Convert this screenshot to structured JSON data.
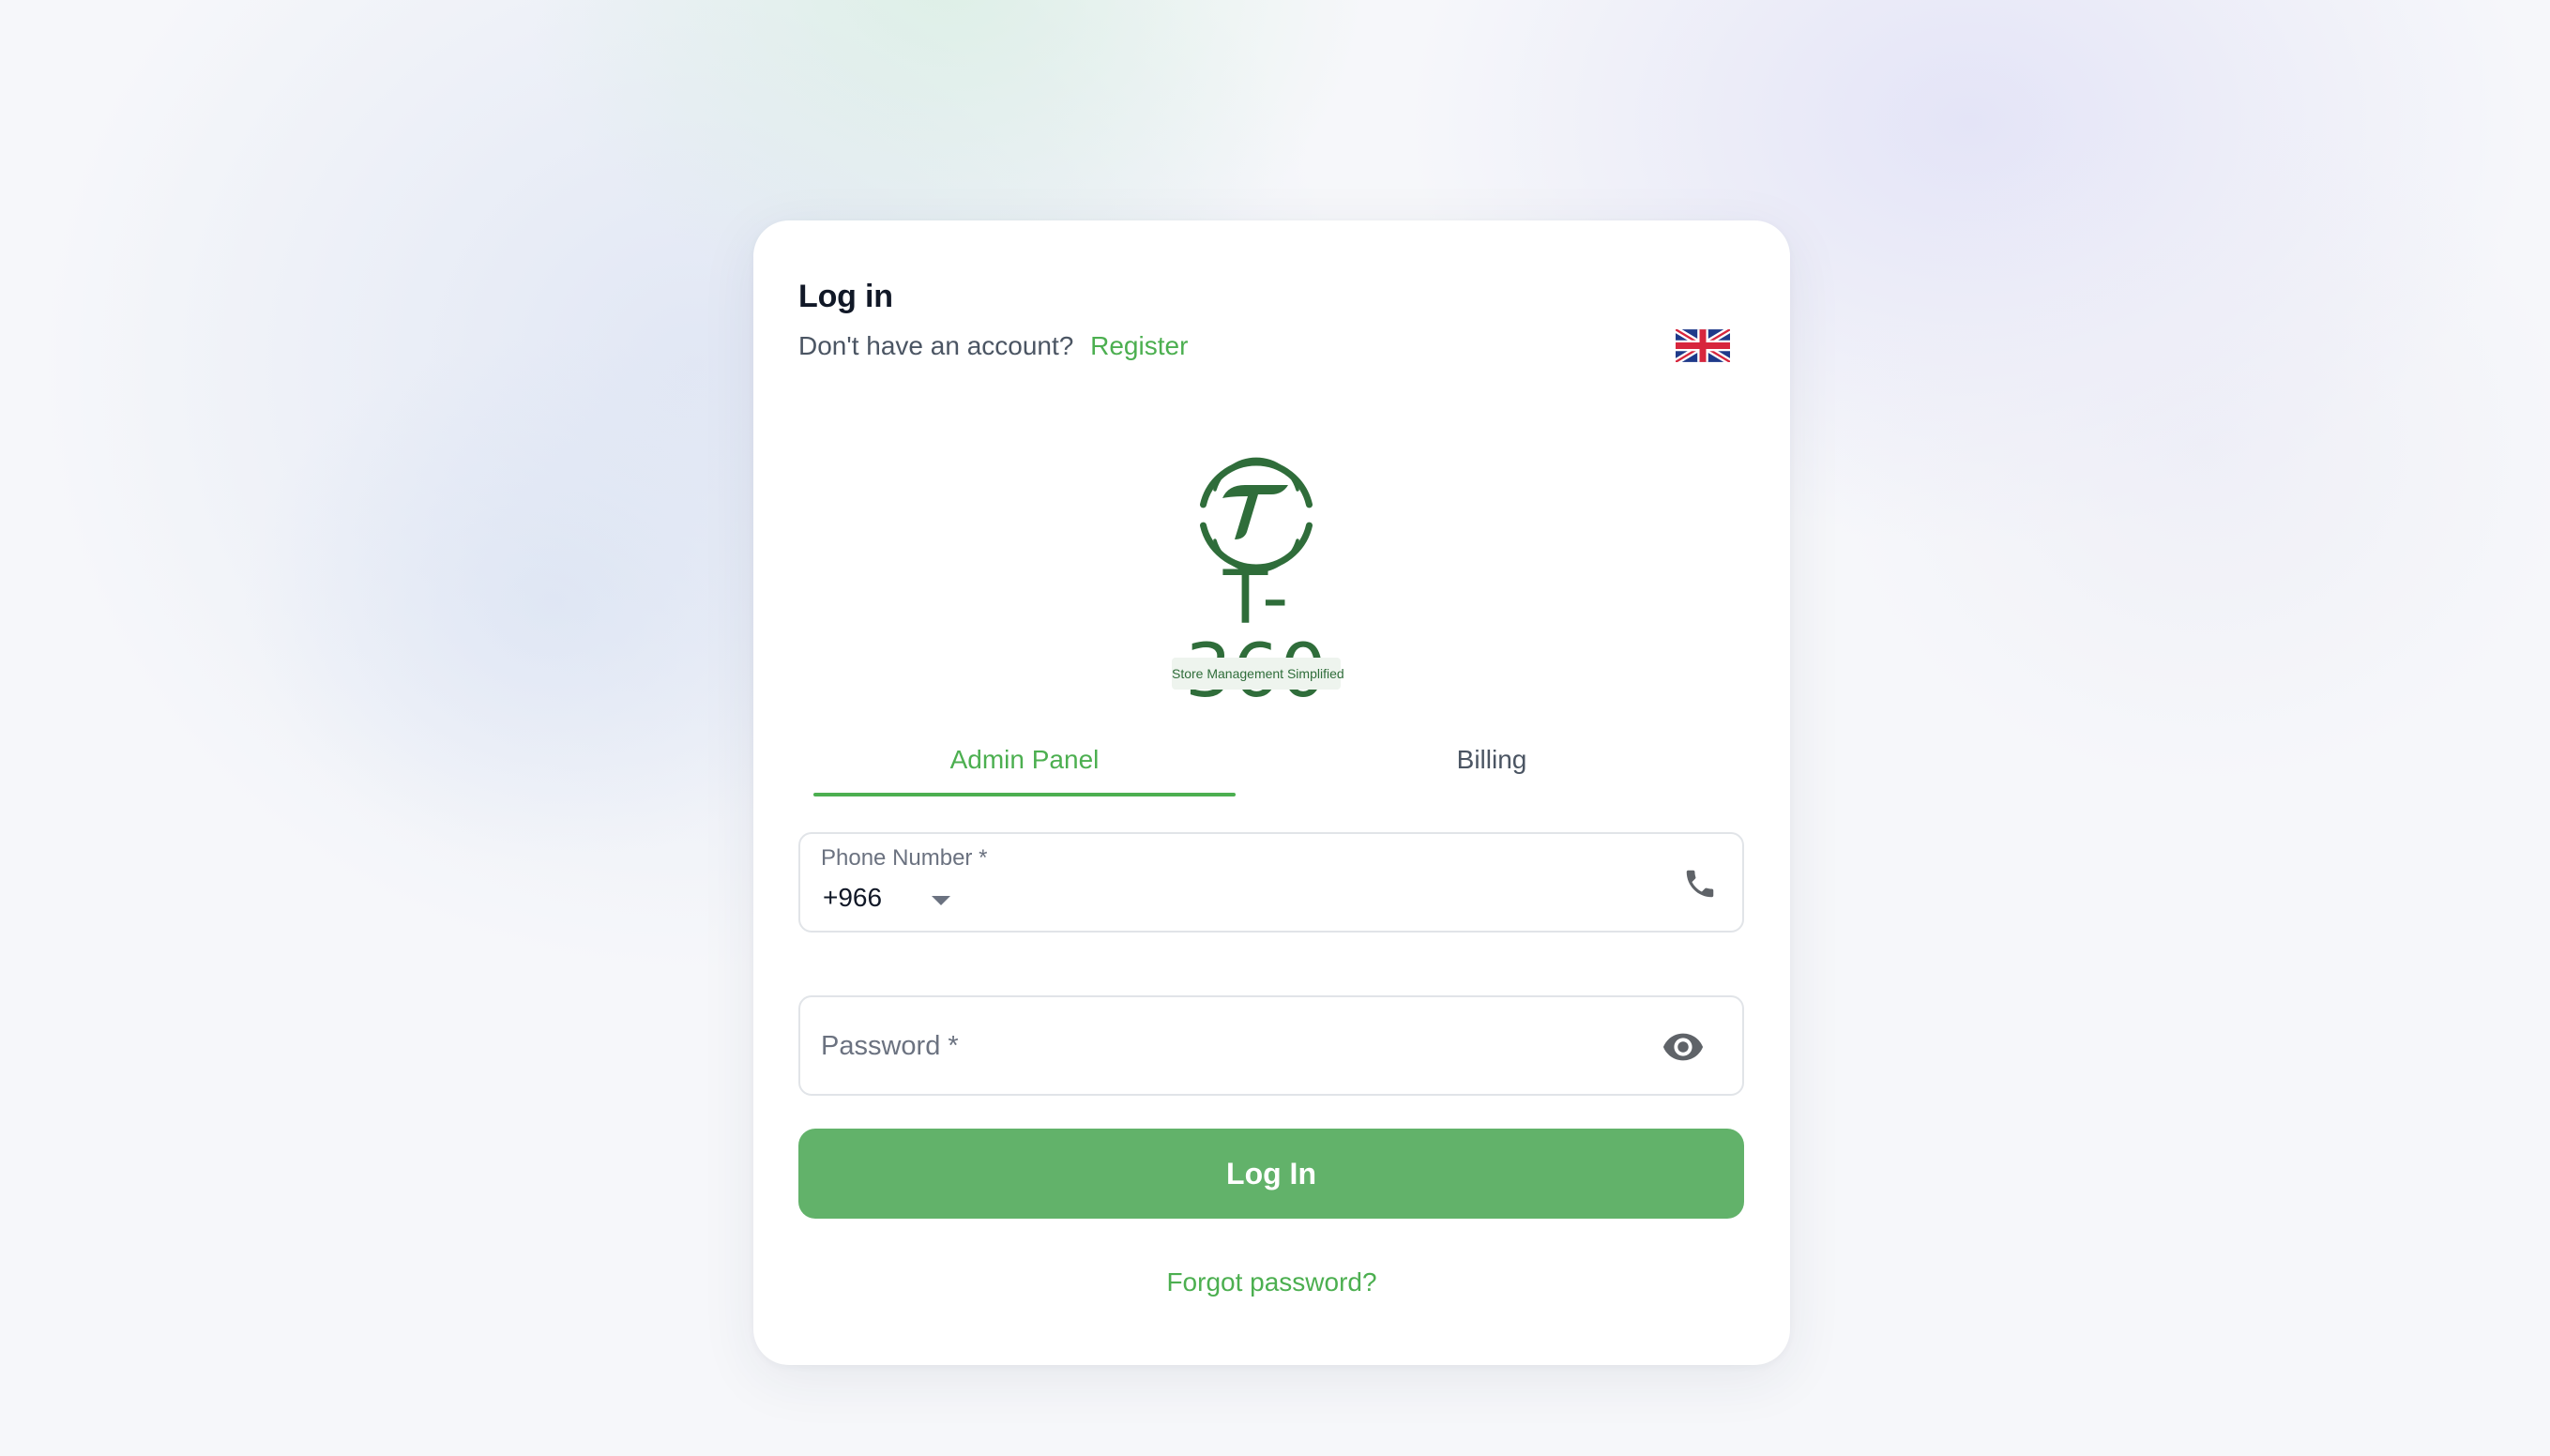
{
  "header": {
    "title": "Log in",
    "prompt_text": "Don't have an account?",
    "register_link": "Register",
    "language_flag_icon": "uk-flag-icon"
  },
  "logo": {
    "wordmark": "T-360",
    "tagline": "Store Management Simplified"
  },
  "tabs": [
    {
      "label": "Admin Panel",
      "active": true
    },
    {
      "label": "Billing",
      "active": false
    }
  ],
  "phone": {
    "label": "Phone Number *",
    "country_code": "+966",
    "icon": "phone-icon"
  },
  "password": {
    "label": "Password *",
    "icon": "eye-icon"
  },
  "actions": {
    "login_label": "Log In",
    "forgot_label": "Forgot password?"
  },
  "colors": {
    "accent": "#4caf50",
    "button": "#62b26a",
    "logo_green": "#2f6d3a",
    "title": "#111827",
    "muted": "#6b7280"
  }
}
